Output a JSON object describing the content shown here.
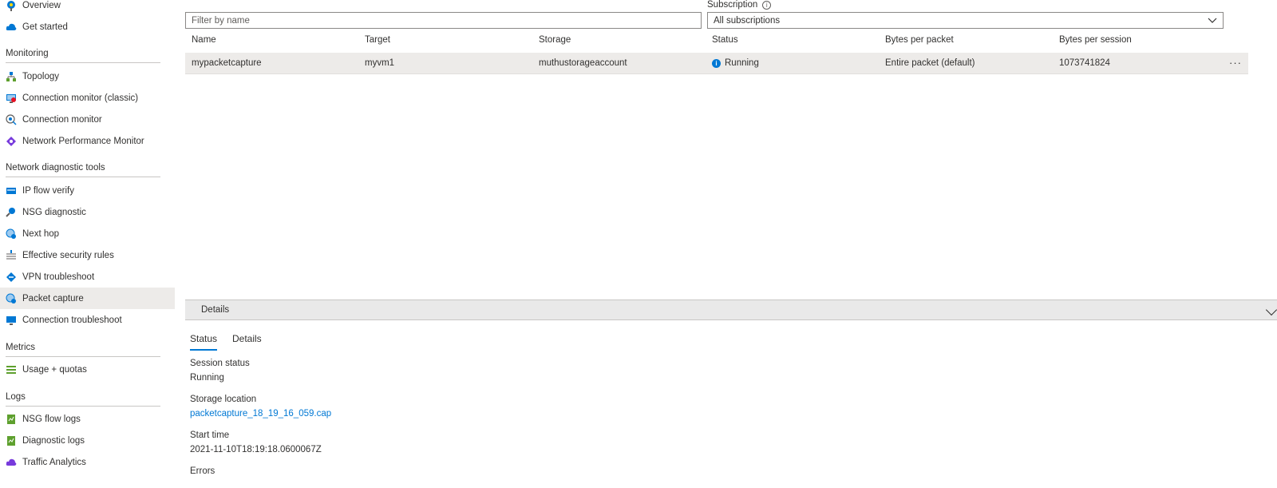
{
  "sidebar": {
    "overview": "Overview",
    "get_started": "Get started",
    "monitoring": {
      "title": "Monitoring",
      "items": [
        "Topology",
        "Connection monitor (classic)",
        "Connection monitor",
        "Network Performance Monitor"
      ]
    },
    "diagnostic": {
      "title": "Network diagnostic tools",
      "items": [
        "IP flow verify",
        "NSG diagnostic",
        "Next hop",
        "Effective security rules",
        "VPN troubleshoot",
        "Packet capture",
        "Connection troubleshoot"
      ]
    },
    "metrics": {
      "title": "Metrics",
      "items": [
        "Usage + quotas"
      ]
    },
    "logs": {
      "title": "Logs",
      "items": [
        "NSG flow logs",
        "Diagnostic logs",
        "Traffic Analytics"
      ]
    }
  },
  "filter": {
    "placeholder": "Filter by name"
  },
  "subscription": {
    "label": "Subscription",
    "info_glyph": "i",
    "value": "All subscriptions"
  },
  "table": {
    "columns": [
      "Name",
      "Target",
      "Storage",
      "Status",
      "Bytes per packet",
      "Bytes per session"
    ],
    "rows": [
      {
        "name": "mypacketcapture",
        "target": "myvm1",
        "storage": "muthustorageaccount",
        "status": "Running",
        "bytes_per_packet": "Entire packet (default)",
        "bytes_per_session": "1073741824"
      }
    ],
    "more": "···"
  },
  "details": {
    "bar_label": "Details",
    "tabs": [
      "Status",
      "Details"
    ],
    "session_status_label": "Session status",
    "session_status_value": "Running",
    "storage_location_label": "Storage location",
    "storage_location_value": "packetcapture_18_19_16_059.cap",
    "start_time_label": "Start time",
    "start_time_value": "2021-11-10T18:19:18.0600067Z",
    "errors_label": "Errors"
  },
  "colors": {
    "accent": "#0078d4",
    "selected_bg": "#edebe9",
    "details_bar_bg": "#e9e9e9"
  }
}
